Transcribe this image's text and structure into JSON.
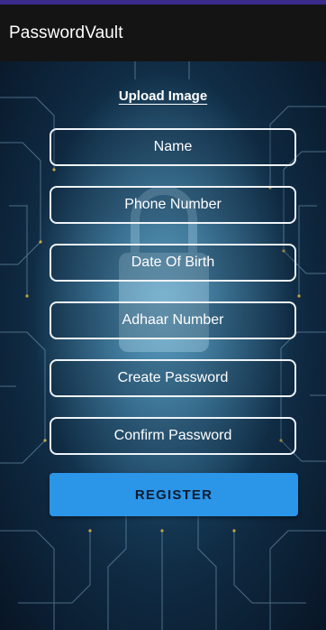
{
  "app_bar": {
    "title": "PasswordVault"
  },
  "form": {
    "upload_label": "Upload Image",
    "fields": [
      {
        "name": "name-field",
        "placeholder": "Name"
      },
      {
        "name": "phone-number-field",
        "placeholder": "Phone Number"
      },
      {
        "name": "date-of-birth-field",
        "placeholder": "Date Of Birth"
      },
      {
        "name": "adhaar-number-field",
        "placeholder": "Adhaar Number"
      },
      {
        "name": "create-password-field",
        "placeholder": "Create Password"
      },
      {
        "name": "confirm-password-field",
        "placeholder": "Confirm Password"
      }
    ],
    "register_label": "REGISTER"
  },
  "colors": {
    "app_bar": "#141414",
    "status_line": "#3a2a8c",
    "accent_button": "#2b95e8",
    "field_border": "#eef3f8",
    "background": "#0f2a42"
  },
  "background_image": "circuit-board-with-padlock"
}
